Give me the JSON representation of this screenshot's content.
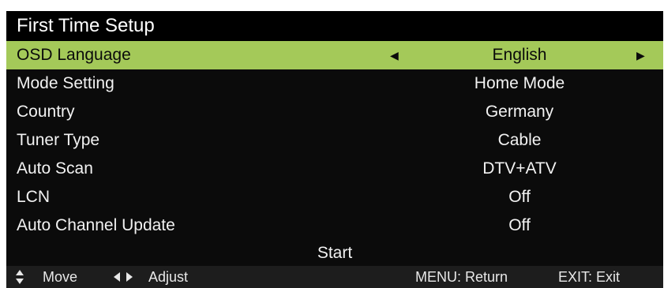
{
  "title": "First Time Setup",
  "rows": [
    {
      "label": "OSD Language",
      "value": "English",
      "selected": true
    },
    {
      "label": "Mode Setting",
      "value": "Home Mode"
    },
    {
      "label": "Country",
      "value": "Germany"
    },
    {
      "label": "Tuner Type",
      "value": "Cable"
    },
    {
      "label": "Auto Scan",
      "value": "DTV+ATV"
    },
    {
      "label": "LCN",
      "value": "Off"
    },
    {
      "label": "Auto Channel Update",
      "value": "Off"
    }
  ],
  "start_label": "Start",
  "footer": {
    "move": "Move",
    "adjust": "Adjust",
    "menu": "MENU: Return",
    "exit": "EXIT: Exit"
  },
  "colors": {
    "highlight": "#a4c959",
    "background": "#0b0b0b",
    "footer_bg": "#1d1d1d",
    "text": "#f2f2f2"
  },
  "icons": {
    "left": "left-triangle",
    "right": "right-triangle",
    "move": "up-down-arrows",
    "adjust": "left-right-triangles"
  }
}
